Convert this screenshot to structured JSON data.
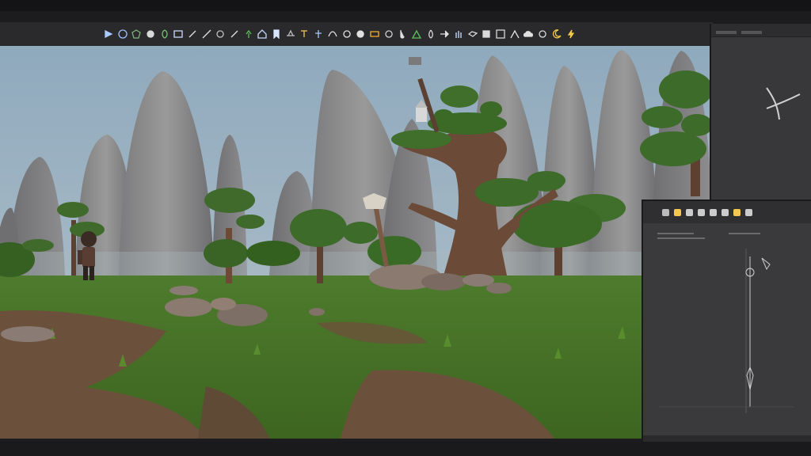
{
  "toolbar": {
    "tools": [
      {
        "name": "select-tool-icon",
        "color": "#a8c8ff"
      },
      {
        "name": "globe-tool-icon",
        "color": "#9cc4ff"
      },
      {
        "name": "shield-tool-icon",
        "color": "#7fb27f"
      },
      {
        "name": "sphere-tool-icon",
        "color": "#d9d9d9"
      },
      {
        "name": "leaf-tool-icon",
        "color": "#6fc36f"
      },
      {
        "name": "book-tool-icon",
        "color": "#cfd9ff"
      },
      {
        "name": "brush-tool-icon",
        "color": "#e0e0e0"
      },
      {
        "name": "pencil-tool-icon",
        "color": "#e0e0e0"
      },
      {
        "name": "circle-tool-icon",
        "color": "#bdbdbd"
      },
      {
        "name": "wrench-tool-icon",
        "color": "#e0e0e0"
      },
      {
        "name": "plant-tool-icon",
        "color": "#5fbf5f"
      },
      {
        "name": "house-tool-icon",
        "color": "#c7d7ff"
      },
      {
        "name": "bookmark-tool-icon",
        "color": "#d7e3ff"
      },
      {
        "name": "cap-tool-icon",
        "color": "#bfbfbf"
      },
      {
        "name": "text-tool-icon",
        "color": "#f2c94c"
      },
      {
        "name": "figure-tool-icon",
        "color": "#a8c8ff"
      },
      {
        "name": "curve-tool-icon",
        "color": "#e0e0e0"
      },
      {
        "name": "ring-tool-icon",
        "color": "#e0e0e0"
      },
      {
        "name": "ring2-tool-icon",
        "color": "#e0e0e0"
      },
      {
        "name": "label-tool-icon",
        "color": "#f2b234"
      },
      {
        "name": "ring3-tool-icon",
        "color": "#cfcfcf"
      },
      {
        "name": "hook-tool-icon",
        "color": "#e0e0e0"
      },
      {
        "name": "mountain-tool-icon",
        "color": "#5fbf5f"
      },
      {
        "name": "droplet-tool-icon",
        "color": "#d9d9d9"
      },
      {
        "name": "arrow-tool-icon",
        "color": "#e0e0e0"
      },
      {
        "name": "hand-tool-icon",
        "color": "#cfe0ff"
      },
      {
        "name": "bird-tool-icon",
        "color": "#d9d9d9"
      },
      {
        "name": "stamp-tool-icon",
        "color": "#d9d9d9"
      },
      {
        "name": "frame-tool-icon",
        "color": "#d9d9d9"
      },
      {
        "name": "peak-tool-icon",
        "color": "#e0e0e0"
      },
      {
        "name": "cloud-tool-icon",
        "color": "#e0e0e0"
      },
      {
        "name": "coin-tool-icon",
        "color": "#d9d9d9"
      },
      {
        "name": "crescent-tool-icon",
        "color": "#f2c94c"
      },
      {
        "name": "bolt-tool-icon",
        "color": "#f2c94c"
      }
    ]
  },
  "properties_toolbar": {
    "icons": [
      {
        "name": "property-undo-icon",
        "color": "#bbbbbb"
      },
      {
        "name": "property-bell-icon",
        "color": "#f2c94c"
      },
      {
        "name": "property-list-icon",
        "color": "#cccccc"
      },
      {
        "name": "property-grid-icon",
        "color": "#cccccc"
      },
      {
        "name": "property-pin-icon",
        "color": "#cccccc"
      },
      {
        "name": "property-arch-icon",
        "color": "#cccccc"
      },
      {
        "name": "property-coin-icon",
        "color": "#f2c94c"
      },
      {
        "name": "property-ring-icon",
        "color": "#cccccc"
      }
    ]
  },
  "colors": {
    "ui_dark": "#1c1c1e",
    "toolbar_bg": "#2a2a2c",
    "panel_bg": "#3a3a3c",
    "sky": "#8aa4b8",
    "grass": "#4f7a2a",
    "soil": "#6a4e37",
    "rock": "#8c8c8c"
  }
}
